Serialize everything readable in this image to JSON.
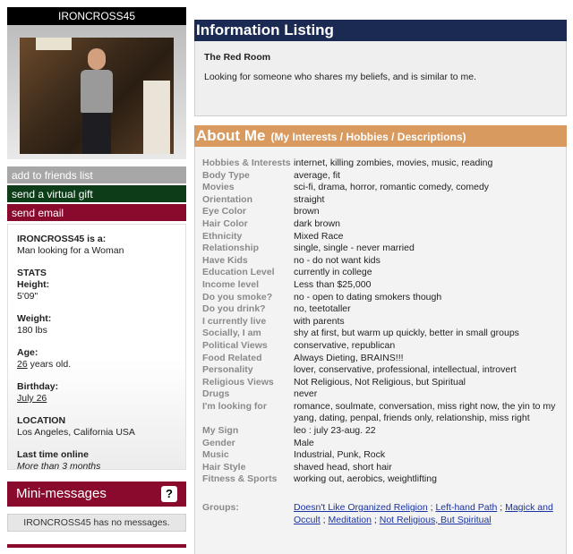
{
  "profile": {
    "username": "IRONCROSS45",
    "actions": {
      "add_friends": "add to friends list",
      "virtual_gift": "send a virtual gift",
      "send_email": "send email"
    },
    "is_a_label": "IRONCROSS45 is a:",
    "is_a_value": "Man looking for a Woman",
    "stats_label": "STATS",
    "height_label": "Height:",
    "height_value": "5'09\"",
    "weight_label": "Weight:",
    "weight_value": "180 lbs",
    "age_label": "Age:",
    "age_number": "26",
    "age_suffix": " years old.",
    "birthday_label": "Birthday:",
    "birthday_value": "July 26",
    "location_label": "LOCATION",
    "location_value": "Los Angeles, California USA",
    "last_time_label": "Last time online",
    "last_time_value": "More than 3 months"
  },
  "mini_messages": {
    "title": "Mini-messages",
    "help_icon": "?",
    "empty_text": "IRONCROSS45 has no messages."
  },
  "information": {
    "header": "Information Listing",
    "title": "The Red Room",
    "description": "Looking for someone who shares my beliefs, and is similar to me."
  },
  "about": {
    "header": "About Me",
    "subheader": "(My Interests / Hobbies / Descriptions)",
    "rows": [
      {
        "label": "Hobbies & Interests",
        "value": "internet, killing zombies, movies, music, reading"
      },
      {
        "label": "Body Type",
        "value": "average, fit"
      },
      {
        "label": "Movies",
        "value": "sci-fi, drama, horror, romantic comedy, comedy"
      },
      {
        "label": "Orientation",
        "value": "straight"
      },
      {
        "label": "Eye Color",
        "value": "brown"
      },
      {
        "label": "Hair Color",
        "value": "dark brown"
      },
      {
        "label": "Ethnicity",
        "value": "Mixed Race"
      },
      {
        "label": "Relationship",
        "value": "single, single - never married"
      },
      {
        "label": "Have Kids",
        "value": "no - do not want kids"
      },
      {
        "label": "Education Level",
        "value": "currently in college"
      },
      {
        "label": "Income level",
        "value": "Less than $25,000"
      },
      {
        "label": "Do you smoke?",
        "value": "no - open to dating smokers though"
      },
      {
        "label": "Do you drink?",
        "value": "no, teetotaller"
      },
      {
        "label": "I currently live",
        "value": "with parents"
      },
      {
        "label": "Socially, I am",
        "value": "shy at first, but warm up quickly, better in small groups"
      },
      {
        "label": "Political Views",
        "value": "conservative, republican"
      },
      {
        "label": "Food Related",
        "value": "Always Dieting, BRAINS!!!"
      },
      {
        "label": "Personality",
        "value": "lover, conservative, professional, intellectual, introvert"
      },
      {
        "label": "Religious Views",
        "value": "Not Religious, Not Religious, but Spiritual"
      },
      {
        "label": "Drugs",
        "value": "never"
      },
      {
        "label": "I'm looking for",
        "value": "romance, soulmate, conversation, miss right now, the yin to my yang, dating, penpal, friends only, relationship, miss right"
      },
      {
        "label": "My Sign",
        "value": "leo : july 23-aug. 22"
      },
      {
        "label": "Gender",
        "value": "Male"
      },
      {
        "label": "Music",
        "value": "Industrial, Punk, Rock"
      },
      {
        "label": "Hair Style",
        "value": "shaved head, short hair"
      },
      {
        "label": "Fitness & Sports",
        "value": "working out, aerobics, weightlifting"
      }
    ],
    "groups_label": "Groups:",
    "groups": [
      "Doesn't Like Organized Religion",
      "Left-hand Path",
      "Magick and Occult",
      "Meditation",
      "Not Religious, But Spiritual"
    ],
    "group_separator": " ; "
  }
}
